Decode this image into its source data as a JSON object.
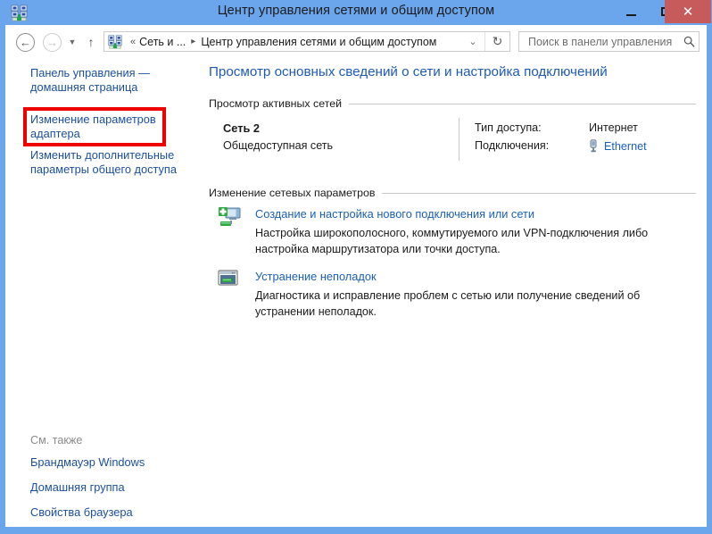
{
  "window": {
    "title": "Центр управления сетями и общим доступом",
    "icon": "network-sharing-icon",
    "controls": {
      "minimize_label": "–",
      "maximize_label": "□",
      "close_label": "✕",
      "close_color": "#c75b5b",
      "titlebar_color": "#6ba5ec"
    }
  },
  "navbar": {
    "back_label": "←",
    "forward_label": "→",
    "recent_label": "▼",
    "up_label": "↑",
    "address": {
      "icon": "network-sharing-icon",
      "chevrons": "«",
      "crumb1": "Сеть и ...",
      "separator": "▸",
      "crumb2": "Центр управления сетями и общим доступом",
      "dropdown_label": "⌄",
      "refresh_label": "↻"
    },
    "search": {
      "placeholder": "Поиск в панели управления",
      "value": "",
      "icon": "search-icon"
    }
  },
  "sidebar": {
    "links": [
      {
        "label": "Панель управления — домашняя страница"
      },
      {
        "label": "Изменение параметров адаптера",
        "highlighted": true
      },
      {
        "label": "Изменить дополнительные параметры общего доступа"
      }
    ],
    "highlight_color": "#ee0000",
    "see_also": {
      "title": "См. также",
      "links": [
        {
          "label": "Брандмауэр Windows"
        },
        {
          "label": "Домашняя группа"
        },
        {
          "label": "Свойства браузера"
        }
      ]
    }
  },
  "main": {
    "heading": "Просмотр основных сведений о сети и настройка подключений",
    "sections": {
      "active_networks": {
        "title": "Просмотр активных сетей",
        "network": {
          "name": "Сеть 2",
          "type": "Общедоступная сеть",
          "access_label": "Тип доступа:",
          "access_value": "Интернет",
          "connections_label": "Подключения:",
          "connections_value": "Ethernet",
          "connections_icon": "ethernet-plug-icon"
        }
      },
      "change_settings": {
        "title": "Изменение сетевых параметров",
        "tasks": [
          {
            "icon": "new-connection-icon",
            "link": "Создание и настройка нового подключения или сети",
            "description": "Настройка широкополосного, коммутируемого или VPN-подключения либо настройка маршрутизатора или точки доступа."
          },
          {
            "icon": "troubleshoot-icon",
            "link": "Устранение неполадок",
            "description": "Диагностика и исправление проблем с сетью или получение сведений об устранении неполадок."
          }
        ]
      }
    }
  }
}
